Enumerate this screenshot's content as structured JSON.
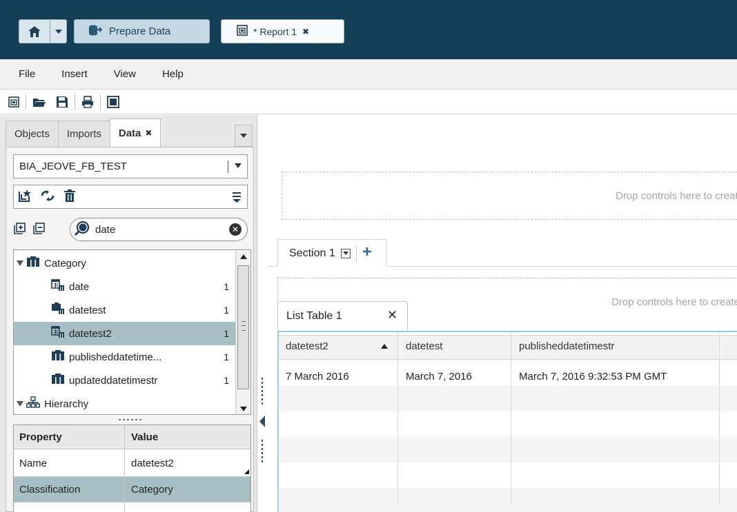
{
  "header": {
    "prepare_label": "Prepare Data",
    "report_tab_label": "* Report 1",
    "report_tab_close": "✖"
  },
  "menu": {
    "items": [
      "File",
      "Insert",
      "View",
      "Help"
    ]
  },
  "left_panel": {
    "tabs": [
      {
        "label": "Objects"
      },
      {
        "label": "Imports"
      },
      {
        "label": "Data",
        "close": "✖",
        "active": true
      }
    ],
    "data_source": "BIA_JEOVE_FB_TEST",
    "search": {
      "value": "date"
    },
    "tree": [
      {
        "type": "group",
        "label": "Category"
      },
      {
        "type": "item",
        "label": "date",
        "count": "1"
      },
      {
        "type": "item",
        "label": "datetest",
        "count": "1"
      },
      {
        "type": "item",
        "label": "datetest2",
        "count": "1",
        "selected": true
      },
      {
        "type": "item",
        "label": "publisheddatetime...",
        "count": "1"
      },
      {
        "type": "item",
        "label": "updateddatetimestr",
        "count": "1"
      },
      {
        "type": "group",
        "label": "Hierarchy"
      }
    ],
    "properties": {
      "headers": [
        "Property",
        "Value"
      ],
      "rows": [
        {
          "property": "Name",
          "value": "datetest2"
        },
        {
          "property": "Classification",
          "value": "Category",
          "selected": true
        }
      ]
    }
  },
  "canvas": {
    "drop_text": "Drop controls here to create",
    "section_label": "Section 1",
    "list_table_label": "List Table 1",
    "table": {
      "columns": [
        "datetest2",
        "datetest",
        "publisheddatetimestr"
      ],
      "rows": [
        [
          "7 March 2016",
          "March 7, 2016",
          "March 7, 2016 9:32:53 PM GMT"
        ]
      ]
    }
  },
  "colors": {
    "top_bar": "#153f56",
    "selection": "#a7bfc4",
    "table_frame": "#9bcbe3"
  },
  "icons": [
    "home-icon",
    "prepare-data-icon",
    "report-icon",
    "new-report-icon",
    "open-folder-icon",
    "save-icon",
    "print-icon",
    "panel-toggle-icon",
    "new-data-item-icon",
    "refresh-icon",
    "delete-icon",
    "menu-icon",
    "expand-all-icon",
    "collapse-all-icon",
    "search-icon",
    "category-icon",
    "date-category-icon",
    "hierarchy-icon"
  ]
}
